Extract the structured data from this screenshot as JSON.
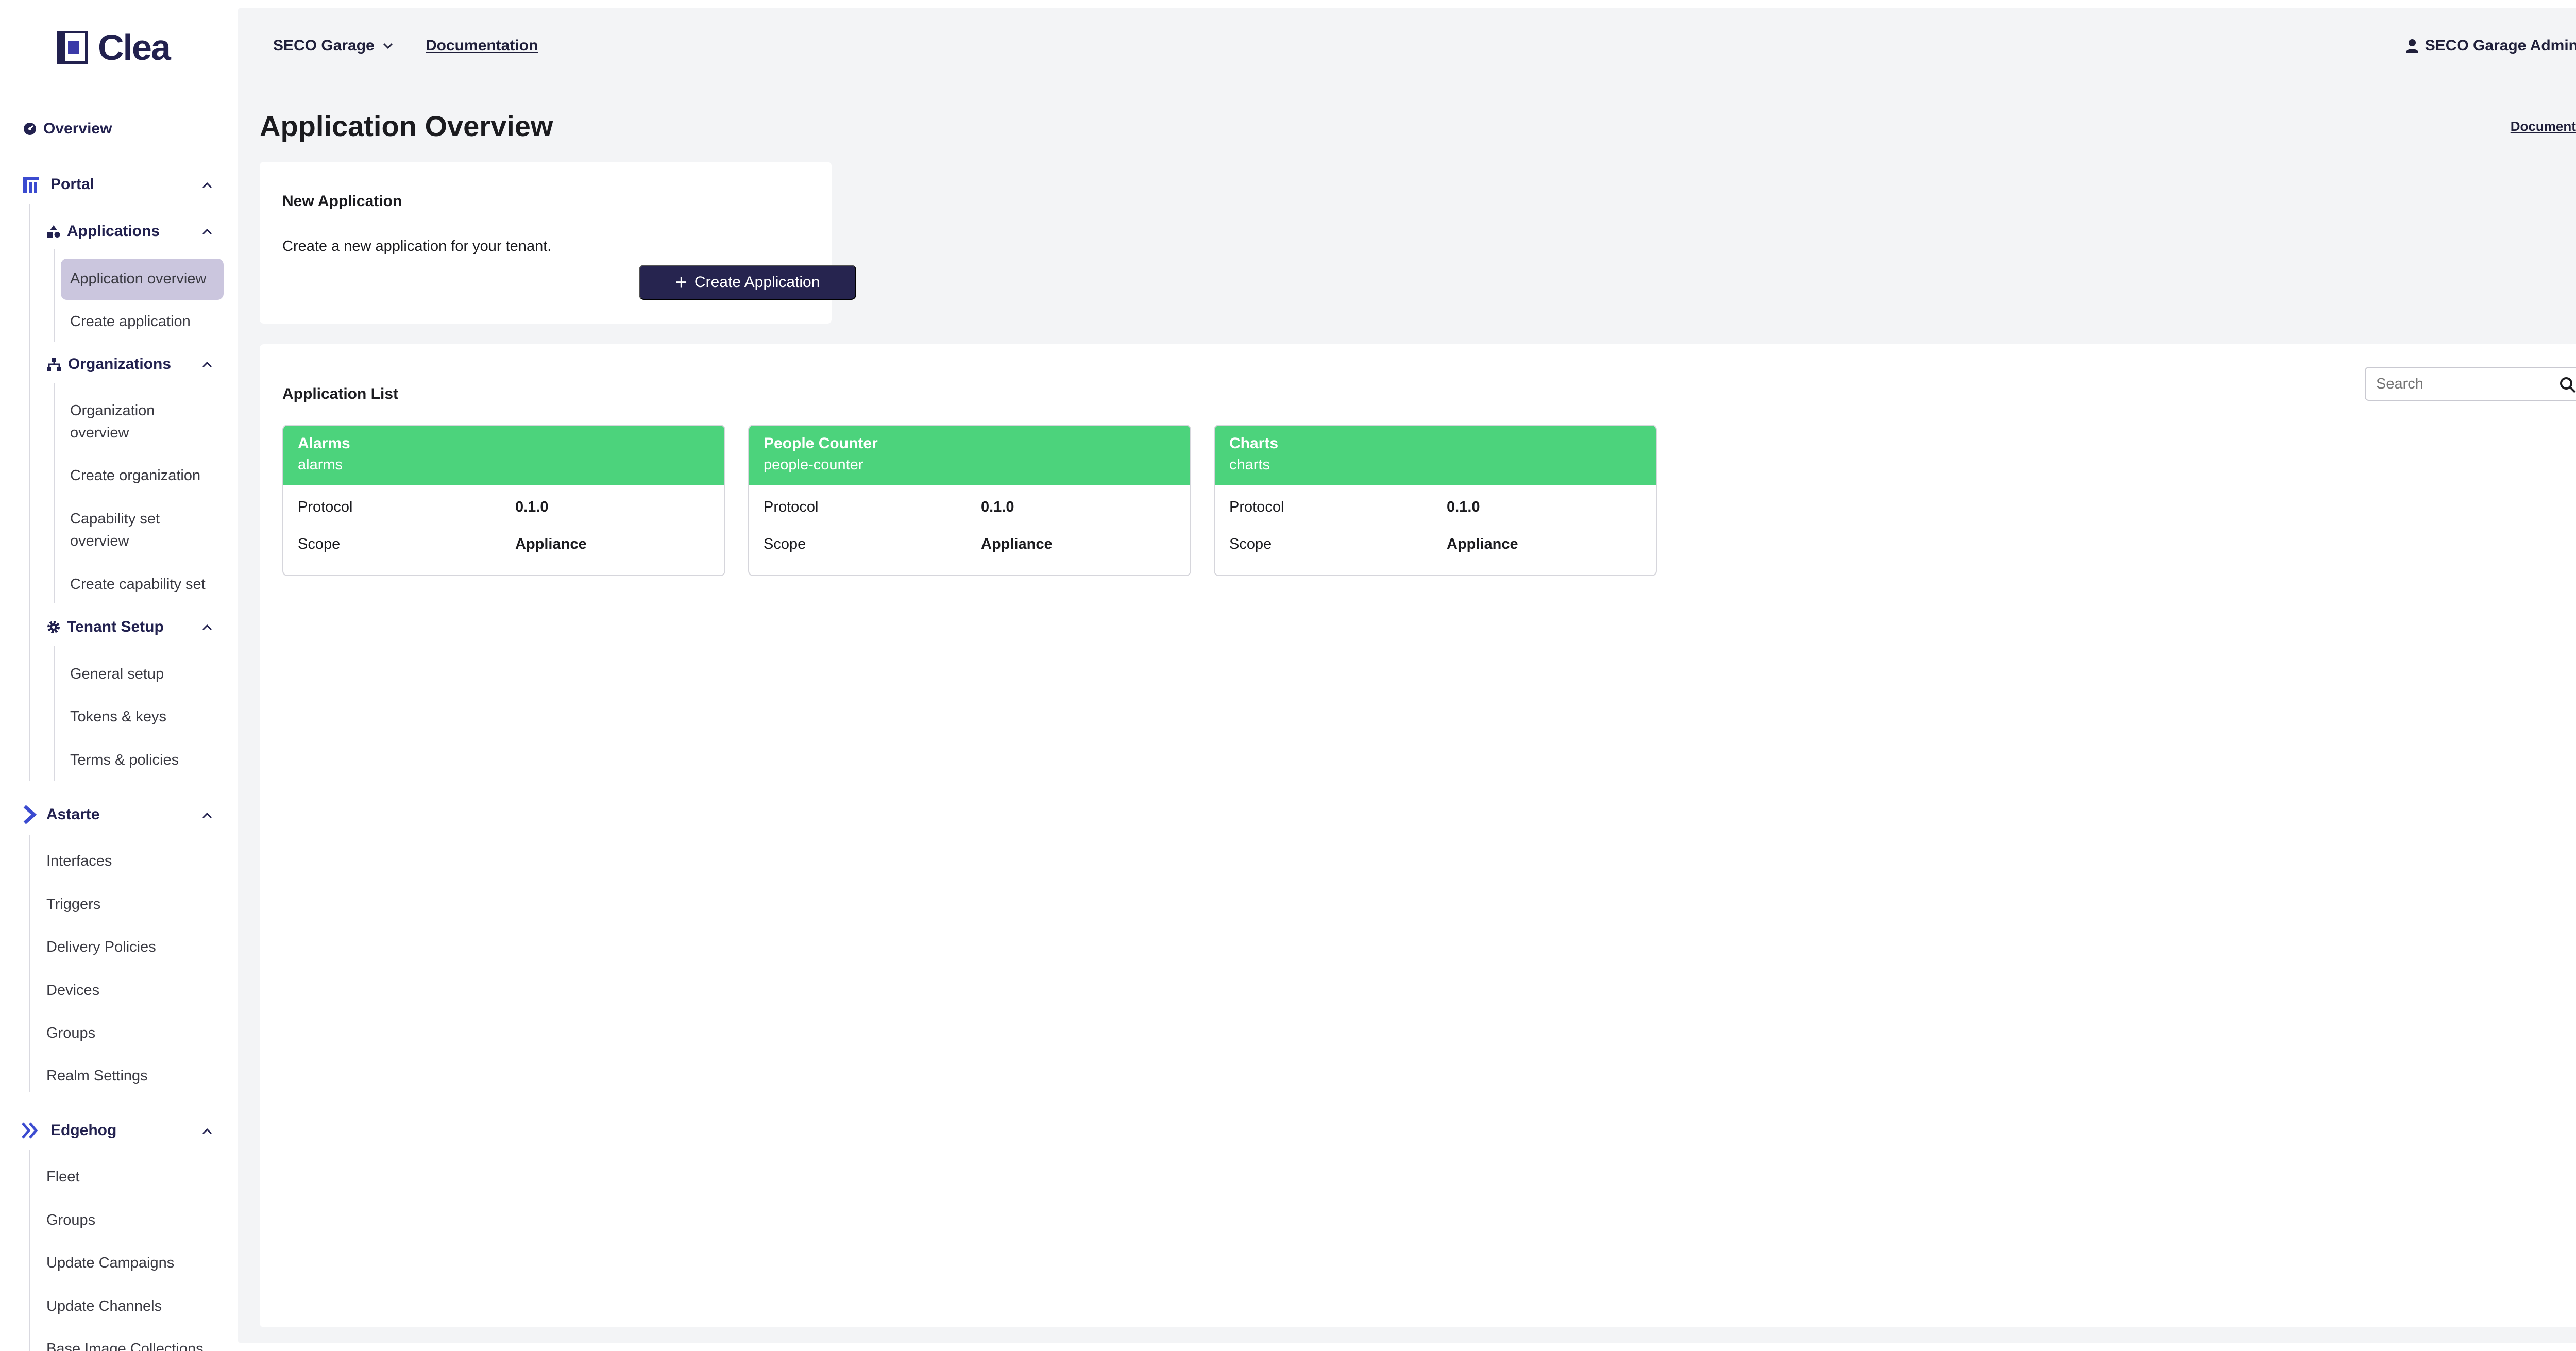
{
  "app": {
    "brand": "Clea"
  },
  "sidebar": {
    "overview": "Overview",
    "portal": {
      "label": "Portal",
      "applications": {
        "label": "Applications",
        "items": [
          "Application overview",
          "Create application"
        ]
      },
      "organizations": {
        "label": "Organizations",
        "items": [
          "Organization overview",
          "Create organization",
          "Capability set overview",
          "Create capability set"
        ]
      },
      "tenant_setup": {
        "label": "Tenant Setup",
        "items": [
          "General setup",
          "Tokens & keys",
          "Terms & policies"
        ]
      }
    },
    "astarte": {
      "label": "Astarte",
      "items": [
        "Interfaces",
        "Triggers",
        "Delivery Policies",
        "Devices",
        "Groups",
        "Realm Settings"
      ]
    },
    "edgehog": {
      "label": "Edgehog",
      "items": [
        "Fleet",
        "Groups",
        "Update Campaigns",
        "Update Channels",
        "Base Image Collections"
      ]
    },
    "active_item": "Application overview"
  },
  "topbar": {
    "tenant": "SECO Garage",
    "documentation": "Documentation",
    "user": "SECO Garage Admin"
  },
  "page": {
    "title": "Application Overview",
    "documentation_link": "Documentation"
  },
  "new_application": {
    "title": "New Application",
    "description": "Create a new application for your tenant.",
    "button": "Create Application"
  },
  "application_list": {
    "title": "Application List",
    "search_placeholder": "Search",
    "header_color": "#4cd37c",
    "apps": [
      {
        "name": "Alarms",
        "slug": "alarms",
        "protocol_label": "Protocol",
        "protocol": "0.1.0",
        "scope_label": "Scope",
        "scope": "Appliance"
      },
      {
        "name": "People Counter",
        "slug": "people-counter",
        "protocol_label": "Protocol",
        "protocol": "0.1.0",
        "scope_label": "Scope",
        "scope": "Appliance"
      },
      {
        "name": "Charts",
        "slug": "charts",
        "protocol_label": "Protocol",
        "protocol": "0.1.0",
        "scope_label": "Scope",
        "scope": "Appliance"
      }
    ]
  },
  "colors": {
    "brand": "#22214f",
    "button": "#26244f",
    "active": "#cbc6de",
    "card_header": "#4cd37c"
  }
}
